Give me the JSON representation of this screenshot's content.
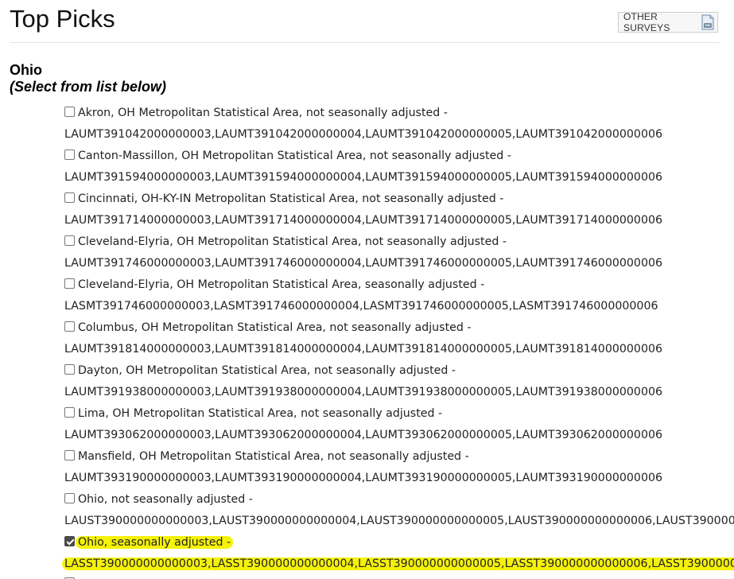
{
  "page": {
    "title": "Top Picks"
  },
  "header": {
    "other_surveys_label": "OTHER SURVEYS",
    "other_surveys_icon": "document-icon"
  },
  "state": {
    "name": "Ohio",
    "instruction": "(Select from list below)"
  },
  "series": [
    {
      "label": "Akron, OH Metropolitan Statistical Area, not seasonally adjusted -",
      "ids": "LAUMT391042000000003,LAUMT391042000000004,LAUMT391042000000005,LAUMT391042000000006",
      "checked": false,
      "highlighted": false
    },
    {
      "label": "Canton-Massillon, OH Metropolitan Statistical Area, not seasonally adjusted -",
      "ids": "LAUMT391594000000003,LAUMT391594000000004,LAUMT391594000000005,LAUMT391594000000006",
      "checked": false,
      "highlighted": false
    },
    {
      "label": "Cincinnati, OH-KY-IN Metropolitan Statistical Area, not seasonally adjusted -",
      "ids": "LAUMT391714000000003,LAUMT391714000000004,LAUMT391714000000005,LAUMT391714000000006",
      "checked": false,
      "highlighted": false
    },
    {
      "label": "Cleveland-Elyria, OH Metropolitan Statistical Area, not seasonally adjusted -",
      "ids": "LAUMT391746000000003,LAUMT391746000000004,LAUMT391746000000005,LAUMT391746000000006",
      "checked": false,
      "highlighted": false
    },
    {
      "label": "Cleveland-Elyria, OH Metropolitan Statistical Area, seasonally adjusted -",
      "ids": "LASMT391746000000003,LASMT391746000000004,LASMT391746000000005,LASMT391746000000006",
      "checked": false,
      "highlighted": false
    },
    {
      "label": "Columbus, OH Metropolitan Statistical Area, not seasonally adjusted -",
      "ids": "LAUMT391814000000003,LAUMT391814000000004,LAUMT391814000000005,LAUMT391814000000006",
      "checked": false,
      "highlighted": false
    },
    {
      "label": "Dayton, OH Metropolitan Statistical Area, not seasonally adjusted -",
      "ids": "LAUMT391938000000003,LAUMT391938000000004,LAUMT391938000000005,LAUMT391938000000006",
      "checked": false,
      "highlighted": false
    },
    {
      "label": "Lima, OH Metropolitan Statistical Area, not seasonally adjusted -",
      "ids": "LAUMT393062000000003,LAUMT393062000000004,LAUMT393062000000005,LAUMT393062000000006",
      "checked": false,
      "highlighted": false
    },
    {
      "label": "Mansfield, OH Metropolitan Statistical Area, not seasonally adjusted -",
      "ids": "LAUMT393190000000003,LAUMT393190000000004,LAUMT393190000000005,LAUMT393190000000006",
      "checked": false,
      "highlighted": false
    },
    {
      "label": "Ohio, not seasonally adjusted -",
      "ids": "LAUST390000000000003,LAUST390000000000004,LAUST390000000000005,LAUST390000000000006,LAUST39000000",
      "checked": false,
      "highlighted": false
    },
    {
      "label": "Ohio, seasonally adjusted -",
      "ids": "LASST390000000000003,LASST390000000000004,LASST390000000000005,LASST390000000000006,LASST39000000",
      "checked": true,
      "highlighted": true
    }
  ],
  "colors": {
    "highlight": "#f5f20a",
    "checkbox_checked": "#4a4a4a"
  }
}
